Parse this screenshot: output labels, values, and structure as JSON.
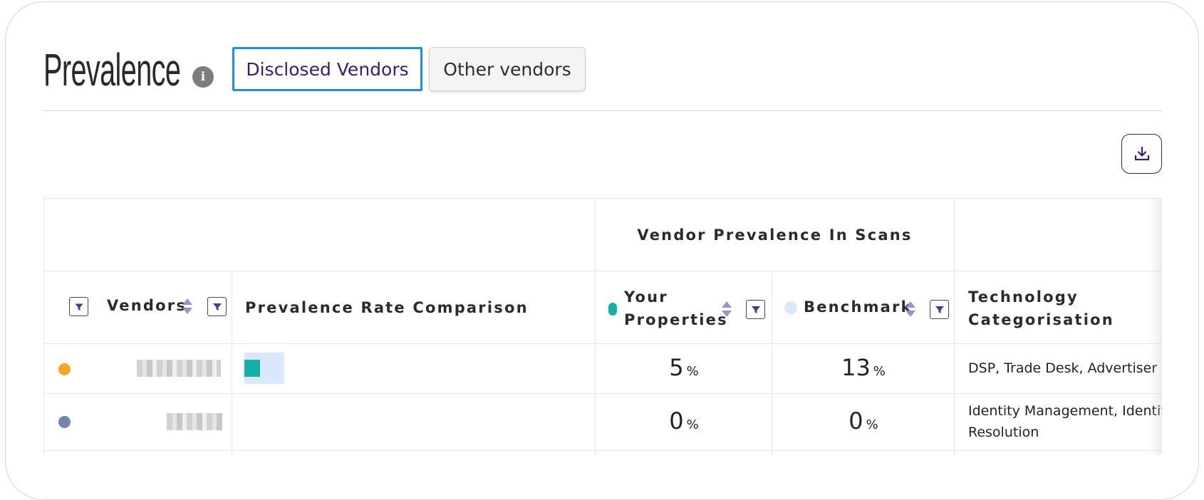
{
  "header": {
    "title": "Prevalence",
    "info_icon": "info-icon",
    "tabs": [
      {
        "label": "Disclosed Vendors",
        "active": true
      },
      {
        "label": "Other vendors",
        "active": false
      }
    ],
    "download_icon": "download-icon"
  },
  "table": {
    "group_header": "Vendor Prevalence In Scans",
    "columns": {
      "vendors": "Vendors",
      "comparison": "Prevalence Rate Comparison",
      "your_properties": "Your Properties",
      "benchmark": "Benchmark",
      "technology": "Technology Categorisation"
    },
    "rows": [
      {
        "dot_color": "#f5a623",
        "vendor_name": "",
        "your_properties": "5",
        "benchmark": "13",
        "pct_symbol": "%",
        "technology": "DSP, Trade Desk, Advertiser So",
        "comparison_your": 5,
        "comparison_benchmark": 13
      },
      {
        "dot_color": "#6f86a8",
        "vendor_name": "",
        "your_properties": "0",
        "benchmark": "0",
        "pct_symbol": "%",
        "technology_line1": "Identity Management, Identity",
        "technology_line2": "Resolution",
        "comparison_your": 0,
        "comparison_benchmark": 0
      }
    ]
  },
  "colors": {
    "accent": "#3d1a78",
    "tab_border": "#1a8fe0",
    "your_properties": "#12b0a6",
    "benchmark": "#d9e8fb",
    "sort_arrows": "#9b8fd0"
  }
}
